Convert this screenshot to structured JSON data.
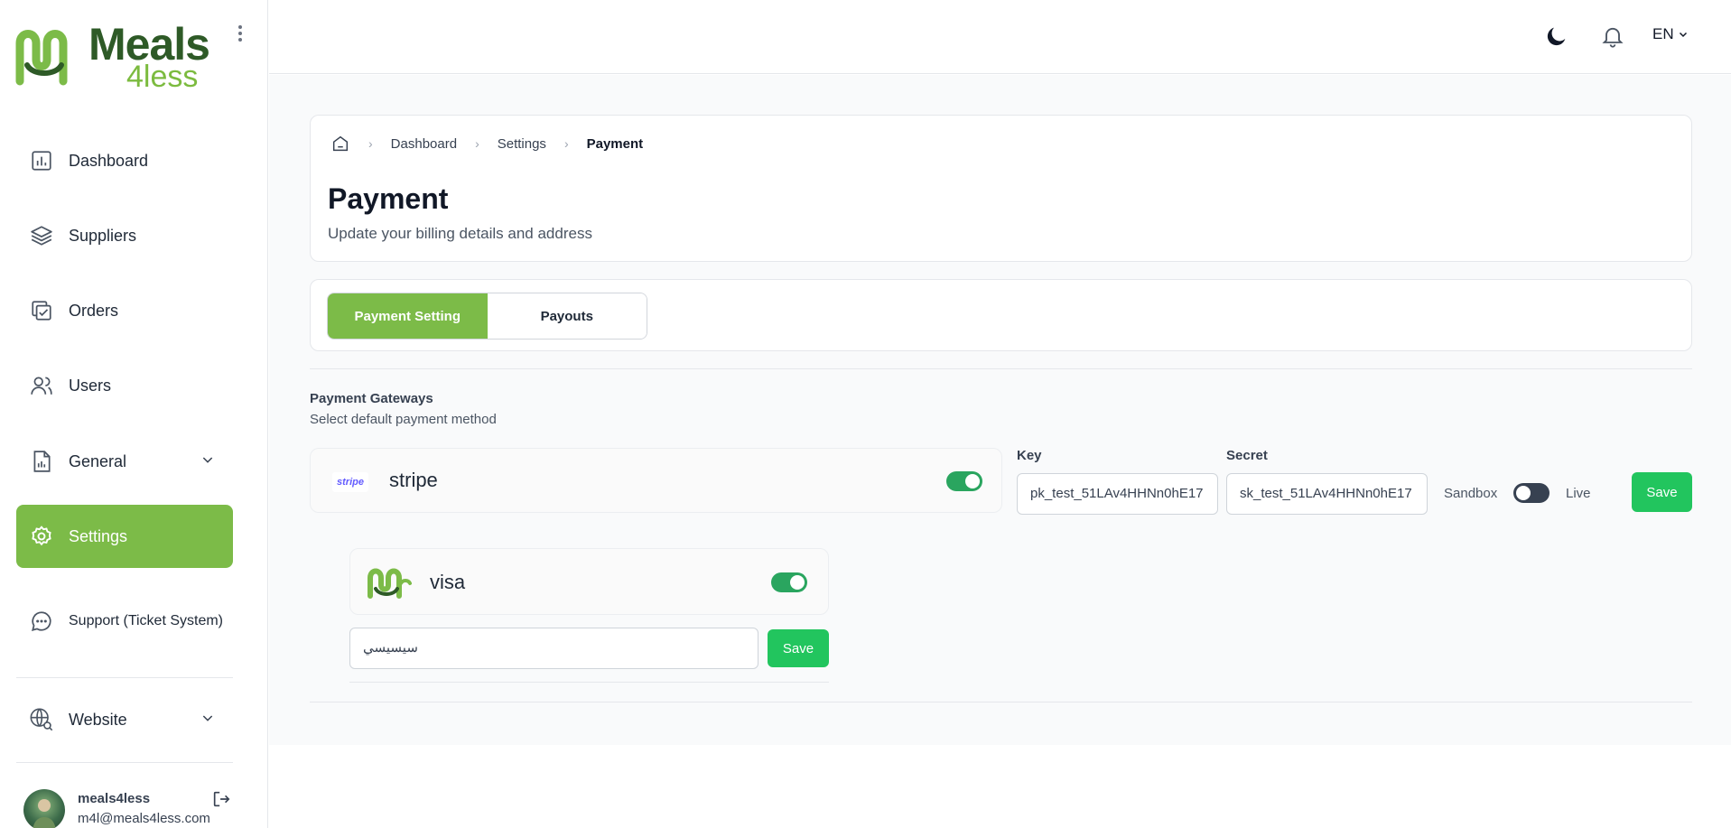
{
  "brand": {
    "name_line1": "Meals",
    "name_line2": "4less",
    "primary_color": "#7cbb48",
    "dark_color": "#2e5a27"
  },
  "sidebar": {
    "items": [
      {
        "label": "Dashboard",
        "icon": "chart-icon"
      },
      {
        "label": "Suppliers",
        "icon": "layers-icon"
      },
      {
        "label": "Orders",
        "icon": "orders-check-icon"
      },
      {
        "label": "Users",
        "icon": "users-icon"
      },
      {
        "label": "General",
        "icon": "report-icon"
      },
      {
        "label": "Settings",
        "icon": "gear-icon"
      },
      {
        "label": "Support (Ticket System)",
        "icon": "chat-icon"
      },
      {
        "label": "Website",
        "icon": "globe-search-icon"
      }
    ],
    "user": {
      "name": "meals4less",
      "email": "m4l@meals4less.com"
    }
  },
  "topbar": {
    "language": "EN"
  },
  "breadcrumb": {
    "home_icon": "home-icon",
    "items": [
      "Dashboard",
      "Settings",
      "Payment"
    ]
  },
  "page": {
    "title": "Payment",
    "subtitle": "Update your billing details and address"
  },
  "tabs": [
    {
      "label": "Payment Setting"
    },
    {
      "label": "Payouts"
    }
  ],
  "gateways": {
    "title": "Payment Gateways",
    "subtitle": "Select default payment method",
    "stripe": {
      "badge": "stripe",
      "name": "stripe",
      "enabled": true,
      "key_label": "Key",
      "key_value": "pk_test_51LAv4HHNn0hE17",
      "secret_label": "Secret",
      "secret_value": "sk_test_51LAv4HHNn0hE17",
      "sandbox_label": "Sandbox",
      "live_label": "Live",
      "mode_live": false,
      "save_label": "Save"
    },
    "visa": {
      "name": "visa",
      "enabled": true,
      "input_value": "سيسيسي",
      "save_label": "Save"
    }
  }
}
